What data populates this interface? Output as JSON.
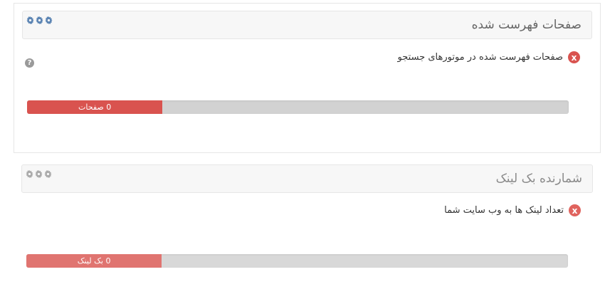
{
  "panels": [
    {
      "title": "صفحات فهرست شده",
      "status": "x",
      "message": "صفحات فهرست شده در موتورهای جستجو",
      "help": "?",
      "progress_label": "0 صفحات",
      "progress_value": 0.25,
      "accent": "#d9534f",
      "gear_color": "#5b84b3",
      "icons": [
        "gear-icon",
        "gear-icon",
        "gear-icon",
        "help-icon",
        "fail-icon"
      ]
    },
    {
      "title": "شمارنده بک لینک",
      "status": "x",
      "message": "تعداد لینک ها به وب سایت شما",
      "progress_label": "0 بک لینک",
      "progress_value": 0.25,
      "accent": "#e07470",
      "gear_color": "#aaaaaa",
      "icons": [
        "gear-icon",
        "gear-icon",
        "gear-icon",
        "fail-icon"
      ]
    }
  ]
}
